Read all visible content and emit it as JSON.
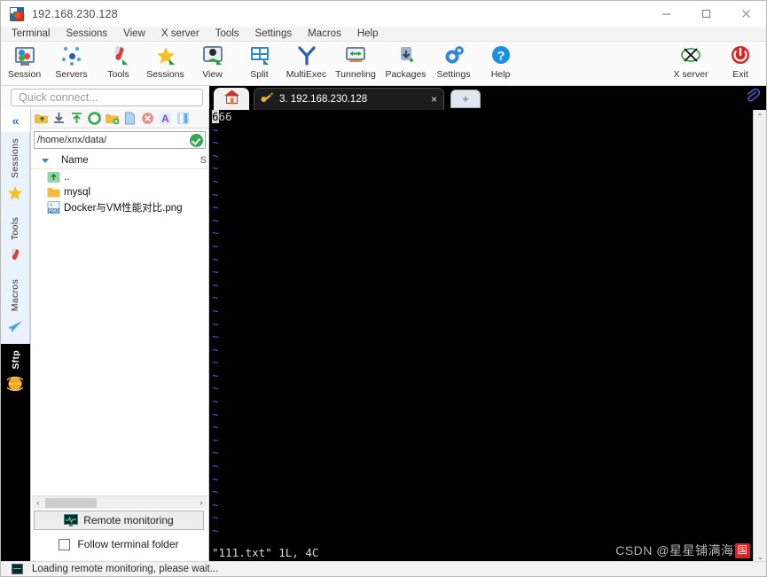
{
  "window": {
    "title": "192.168.230.128",
    "app_icon": "mobaxterm-icon",
    "minimize": "minimize-icon",
    "maximize": "maximize-icon",
    "close": "close-icon"
  },
  "menu": {
    "items": [
      {
        "label": "Terminal"
      },
      {
        "label": "Sessions"
      },
      {
        "label": "View"
      },
      {
        "label": "X server"
      },
      {
        "label": "Tools"
      },
      {
        "label": "Settings"
      },
      {
        "label": "Macros"
      },
      {
        "label": "Help"
      }
    ]
  },
  "toolbar": {
    "left_buttons": [
      {
        "label": "Session",
        "icon": "session-icon"
      },
      {
        "label": "Servers",
        "icon": "servers-icon"
      },
      {
        "label": "Tools",
        "icon": "tools-icon"
      },
      {
        "label": "Sessions",
        "icon": "sessions-star-icon"
      },
      {
        "label": "View",
        "icon": "view-icon"
      },
      {
        "label": "Split",
        "icon": "split-icon"
      },
      {
        "label": "MultiExec",
        "icon": "multiexec-icon"
      },
      {
        "label": "Tunneling",
        "icon": "tunneling-icon"
      },
      {
        "label": "Packages",
        "icon": "packages-icon"
      },
      {
        "label": "Settings",
        "icon": "settings-gear-icon"
      },
      {
        "label": "Help",
        "icon": "help-icon"
      }
    ],
    "right_buttons": [
      {
        "label": "X server",
        "icon": "xserver-icon"
      },
      {
        "label": "Exit",
        "icon": "exit-power-icon"
      }
    ]
  },
  "sidebar": {
    "quick_connect_placeholder": "Quick connect...",
    "collapse_label": "«",
    "tabs": [
      {
        "label": "Sessions",
        "icon": "star-icon"
      },
      {
        "label": "Tools",
        "icon": "swiss-knife-icon"
      },
      {
        "label": "Macros",
        "icon": "paper-plane-icon"
      },
      {
        "label": "Sftp",
        "icon": "globe-icon",
        "active": true
      }
    ]
  },
  "sftp": {
    "toolbar_icons": [
      "parent-folder-icon",
      "download-icon",
      "upload-icon",
      "refresh-icon",
      "new-folder-icon",
      "new-file-icon",
      "delete-icon",
      "text-editor-icon",
      "terminal-view-icon"
    ],
    "path": "/home/xnx/data/",
    "path_status": "connected-check",
    "columns": {
      "name": "Name",
      "size": "S"
    },
    "files": [
      {
        "name": "..",
        "icon": "parent-folder-icon"
      },
      {
        "name": "mysql",
        "icon": "folder-icon"
      },
      {
        "name": "Docker与VM性能对比.png",
        "icon": "png-file-icon"
      }
    ],
    "hscroll": {
      "left_arrow": "‹",
      "right_arrow": "›"
    },
    "remote_monitoring_label": "Remote monitoring",
    "follow_terminal_label": "Follow terminal folder",
    "follow_terminal_checked": false
  },
  "tabs": {
    "home": {
      "icon": "home-icon"
    },
    "terminal_tab": {
      "icon": "ssh-key-icon",
      "label": "3. 192.168.230.128",
      "close": "×"
    },
    "new_tab": "+",
    "attach_icon": "paperclip-icon"
  },
  "terminal": {
    "content_line": "666",
    "cursor_char": "6",
    "rest_chars": "66",
    "tilde": "~",
    "tilde_rows": 32,
    "status_line": "\"111.txt\" 1L, 4C",
    "scroll_up": "⌃",
    "scroll_down": "⌄"
  },
  "statusbar": {
    "icon": "remote-monitoring-icon",
    "text": "Loading remote monitoring, please wait..."
  },
  "watermark": {
    "text": "CSDN @星星铺满海面",
    "badge": "国"
  },
  "colors": {
    "accent_blue": "#2e6fb7",
    "terminal_bg": "#000000",
    "tilde_blue": "#5b5bd6",
    "ok_green": "#2fa84f",
    "exit_red": "#e02020"
  }
}
